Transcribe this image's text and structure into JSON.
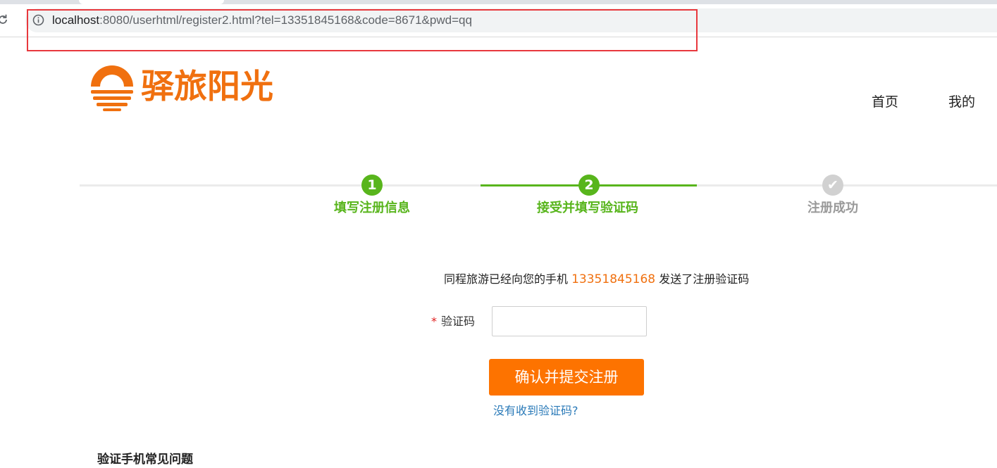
{
  "browser": {
    "url_host": "localhost",
    "url_rest": ":8080/userhtml/register2.html?tel=13351845168&code=8671&pwd=qq"
  },
  "header": {
    "logo_text": "驿旅阳光",
    "nav": [
      "首页",
      "我的"
    ]
  },
  "steps": [
    {
      "number": "1",
      "label": "填写注册信息",
      "state": "done"
    },
    {
      "number": "2",
      "label": "接受并填写验证码",
      "state": "active"
    },
    {
      "number": "✔",
      "label": "注册成功",
      "state": "pending"
    }
  ],
  "form": {
    "message_prefix": "同程旅游已经向您的手机",
    "phone": "13351845168",
    "message_suffix": "发送了注册验证码",
    "required_mark": "*",
    "code_label": "验证码",
    "code_value": "",
    "submit_label": "确认并提交注册",
    "no_code_link": "没有收到验证码?"
  },
  "footer_heading": "验证手机常见问题",
  "colors": {
    "brand_orange": "#f0700f",
    "button_orange": "#fd7300",
    "step_green": "#58b51c",
    "step_gray": "#d1d1d1",
    "link_blue": "#2a7ab8",
    "highlight_red": "#e8383d"
  }
}
